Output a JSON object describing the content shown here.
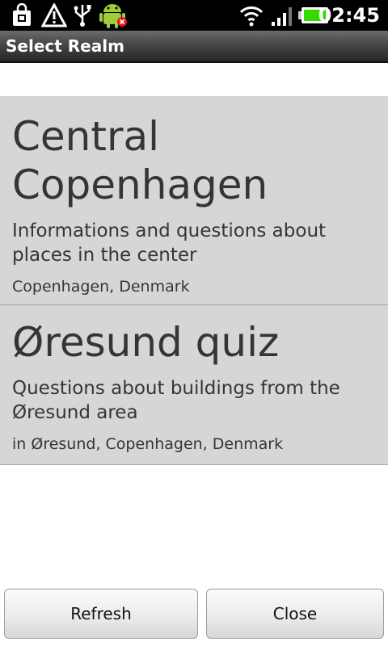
{
  "status_bar": {
    "icons": [
      "shopping-bag-icon",
      "warning-icon",
      "usb-icon",
      "android-debug-icon",
      "wifi-icon",
      "signal-icon",
      "battery-icon"
    ],
    "time": "02:45"
  },
  "title_bar": {
    "title": "Select Realm"
  },
  "realms": [
    {
      "title": "Central Copenhagen",
      "description": "Informations and questions about places in the center",
      "location": "Copenhagen, Denmark"
    },
    {
      "title": "Øresund quiz",
      "description": "Questions about buildings from the Øresund area",
      "location": "in Øresund, Copenhagen, Denmark"
    }
  ],
  "buttons": {
    "refresh": "Refresh",
    "close": "Close"
  },
  "colors": {
    "list_bg": "#d6d6d6",
    "text": "#353535",
    "battery": "#36d800"
  }
}
